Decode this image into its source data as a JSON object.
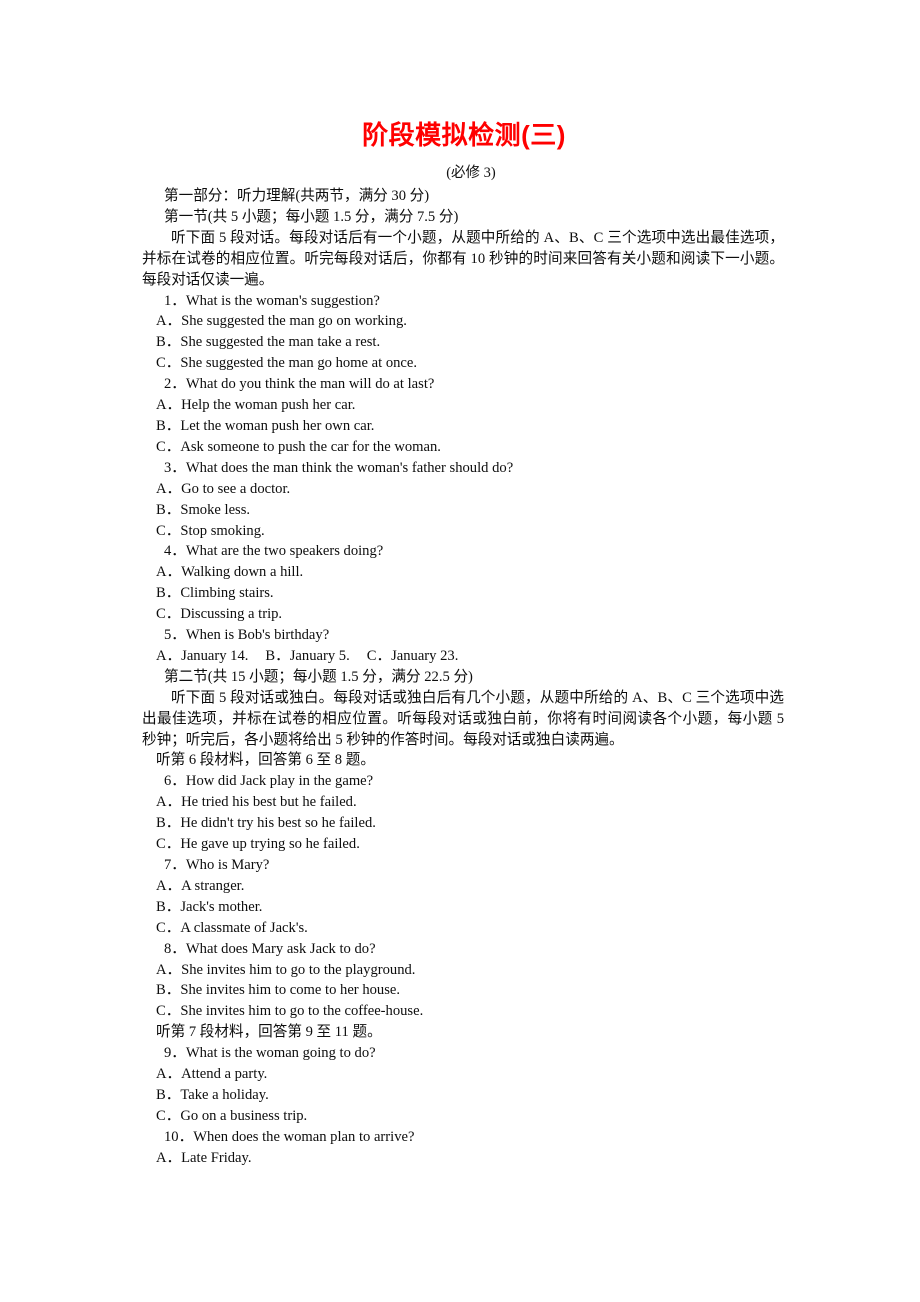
{
  "document": {
    "title": "阶段模拟检测(三)",
    "subtitle": "(必修 3)",
    "title_color": "#ff0000"
  },
  "part_one": {
    "heading": "第一部分：听力理解(共两节，满分 30 分)",
    "section_one": {
      "heading": "第一节(共 5 小题；每小题 1.5 分，满分 7.5 分)",
      "instructions": "听下面 5 段对话。每段对话后有一个小题，从题中所给的 A、B、C 三个选项中选出最佳选项，并标在试卷的相应位置。听完每段对话后，你都有 10 秒钟的时间来回答有关小题和阅读下一小题。每段对话仅读一遍。",
      "questions": [
        {
          "number": "1．",
          "stem": "What is the woman's suggestion?",
          "options": [
            {
              "label": "A．",
              "text": "She suggested the man go on working."
            },
            {
              "label": "B．",
              "text": "She suggested the man take a rest."
            },
            {
              "label": "C．",
              "text": "She suggested the man go home at once."
            }
          ]
        },
        {
          "number": "2．",
          "stem": "What do you think the man will do at last?",
          "options": [
            {
              "label": "A．",
              "text": "Help the woman push her car."
            },
            {
              "label": "B．",
              "text": "Let the woman push her own car."
            },
            {
              "label": "C．",
              "text": "Ask someone to push the car for the woman."
            }
          ]
        },
        {
          "number": "3．",
          "stem": "What does the man think the woman's father should do?",
          "options": [
            {
              "label": "A．",
              "text": "Go to see a doctor."
            },
            {
              "label": "B．",
              "text": "Smoke less."
            },
            {
              "label": "C．",
              "text": "Stop smoking."
            }
          ]
        },
        {
          "number": "4．",
          "stem": "What are the two speakers doing?",
          "options": [
            {
              "label": "A．",
              "text": "Walking down a hill."
            },
            {
              "label": "B．",
              "text": "Climbing stairs."
            },
            {
              "label": "C．",
              "text": "Discussing a trip."
            }
          ]
        },
        {
          "number": "5．",
          "stem": "When is Bob's birthday?",
          "inline_options": [
            {
              "label": "A．",
              "text": "January 14."
            },
            {
              "label": "B．",
              "text": "January 5."
            },
            {
              "label": "C．",
              "text": "January 23."
            }
          ]
        }
      ]
    },
    "section_two": {
      "heading": "第二节(共 15 小题；每小题 1.5 分，满分 22.5 分)",
      "instructions": "听下面 5 段对话或独白。每段对话或独白后有几个小题，从题中所给的 A、B、C 三个选项中选出最佳选项，并标在试卷的相应位置。听每段对话或独白前，你将有时间阅读各个小题，每小题 5 秒钟；听完后，各小题将给出 5 秒钟的作答时间。每段对话或独白读两遍。",
      "cue_six": "听第 6 段材料，回答第 6 至 8 题。",
      "questions_six_to_eight": [
        {
          "number": "6．",
          "stem": "How did Jack play in the game?",
          "options": [
            {
              "label": "A．",
              "text": "He tried his best but he failed."
            },
            {
              "label": "B．",
              "text": "He didn't try his best so he failed."
            },
            {
              "label": "C．",
              "text": "He gave up trying so he failed."
            }
          ]
        },
        {
          "number": "7．",
          "stem": "Who is Mary?",
          "options": [
            {
              "label": "A．",
              "text": "A stranger."
            },
            {
              "label": "B．",
              "text": "Jack's mother."
            },
            {
              "label": "C．",
              "text": "A classmate of Jack's."
            }
          ]
        },
        {
          "number": "8．",
          "stem": "What does Mary ask Jack to do?",
          "options": [
            {
              "label": "A．",
              "text": "She invites him to go to the playground."
            },
            {
              "label": "B．",
              "text": "She invites him to come to her house."
            },
            {
              "label": "C．",
              "text": "She invites him to go to the coffee-house."
            }
          ]
        }
      ],
      "cue_seven": "听第 7 段材料，回答第 9 至 11 题。",
      "questions_nine_to_ten": [
        {
          "number": "9．",
          "stem": "What is the woman going to do?",
          "options": [
            {
              "label": "A．",
              "text": "Attend a party."
            },
            {
              "label": "B．",
              "text": "Take a holiday."
            },
            {
              "label": "C．",
              "text": "Go on a business trip."
            }
          ]
        },
        {
          "number": "10．",
          "stem": "When does the woman plan to arrive?",
          "options": [
            {
              "label": "A．",
              "text": "Late Friday."
            }
          ]
        }
      ]
    }
  }
}
